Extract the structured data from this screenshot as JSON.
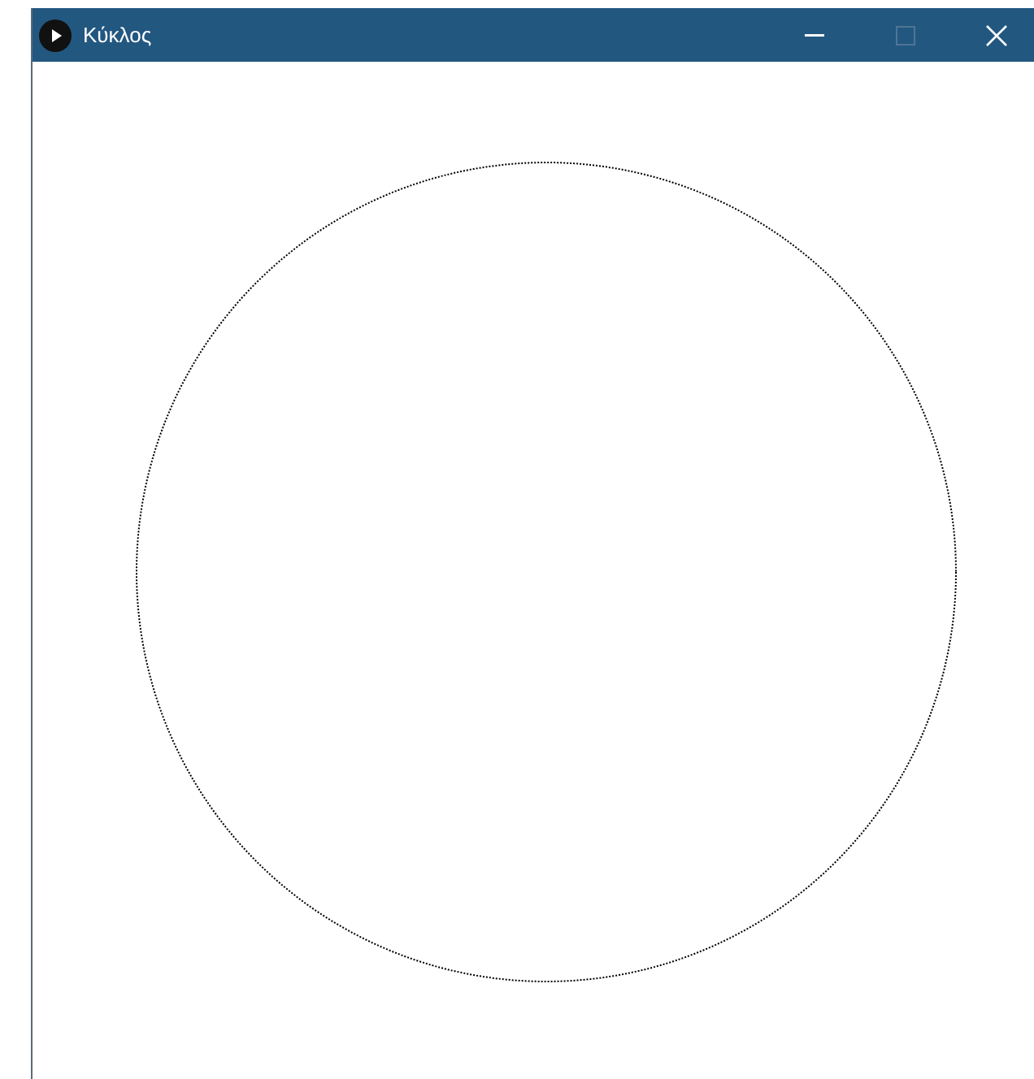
{
  "window": {
    "title": "Κύκλος",
    "maximize_disabled": true
  }
}
